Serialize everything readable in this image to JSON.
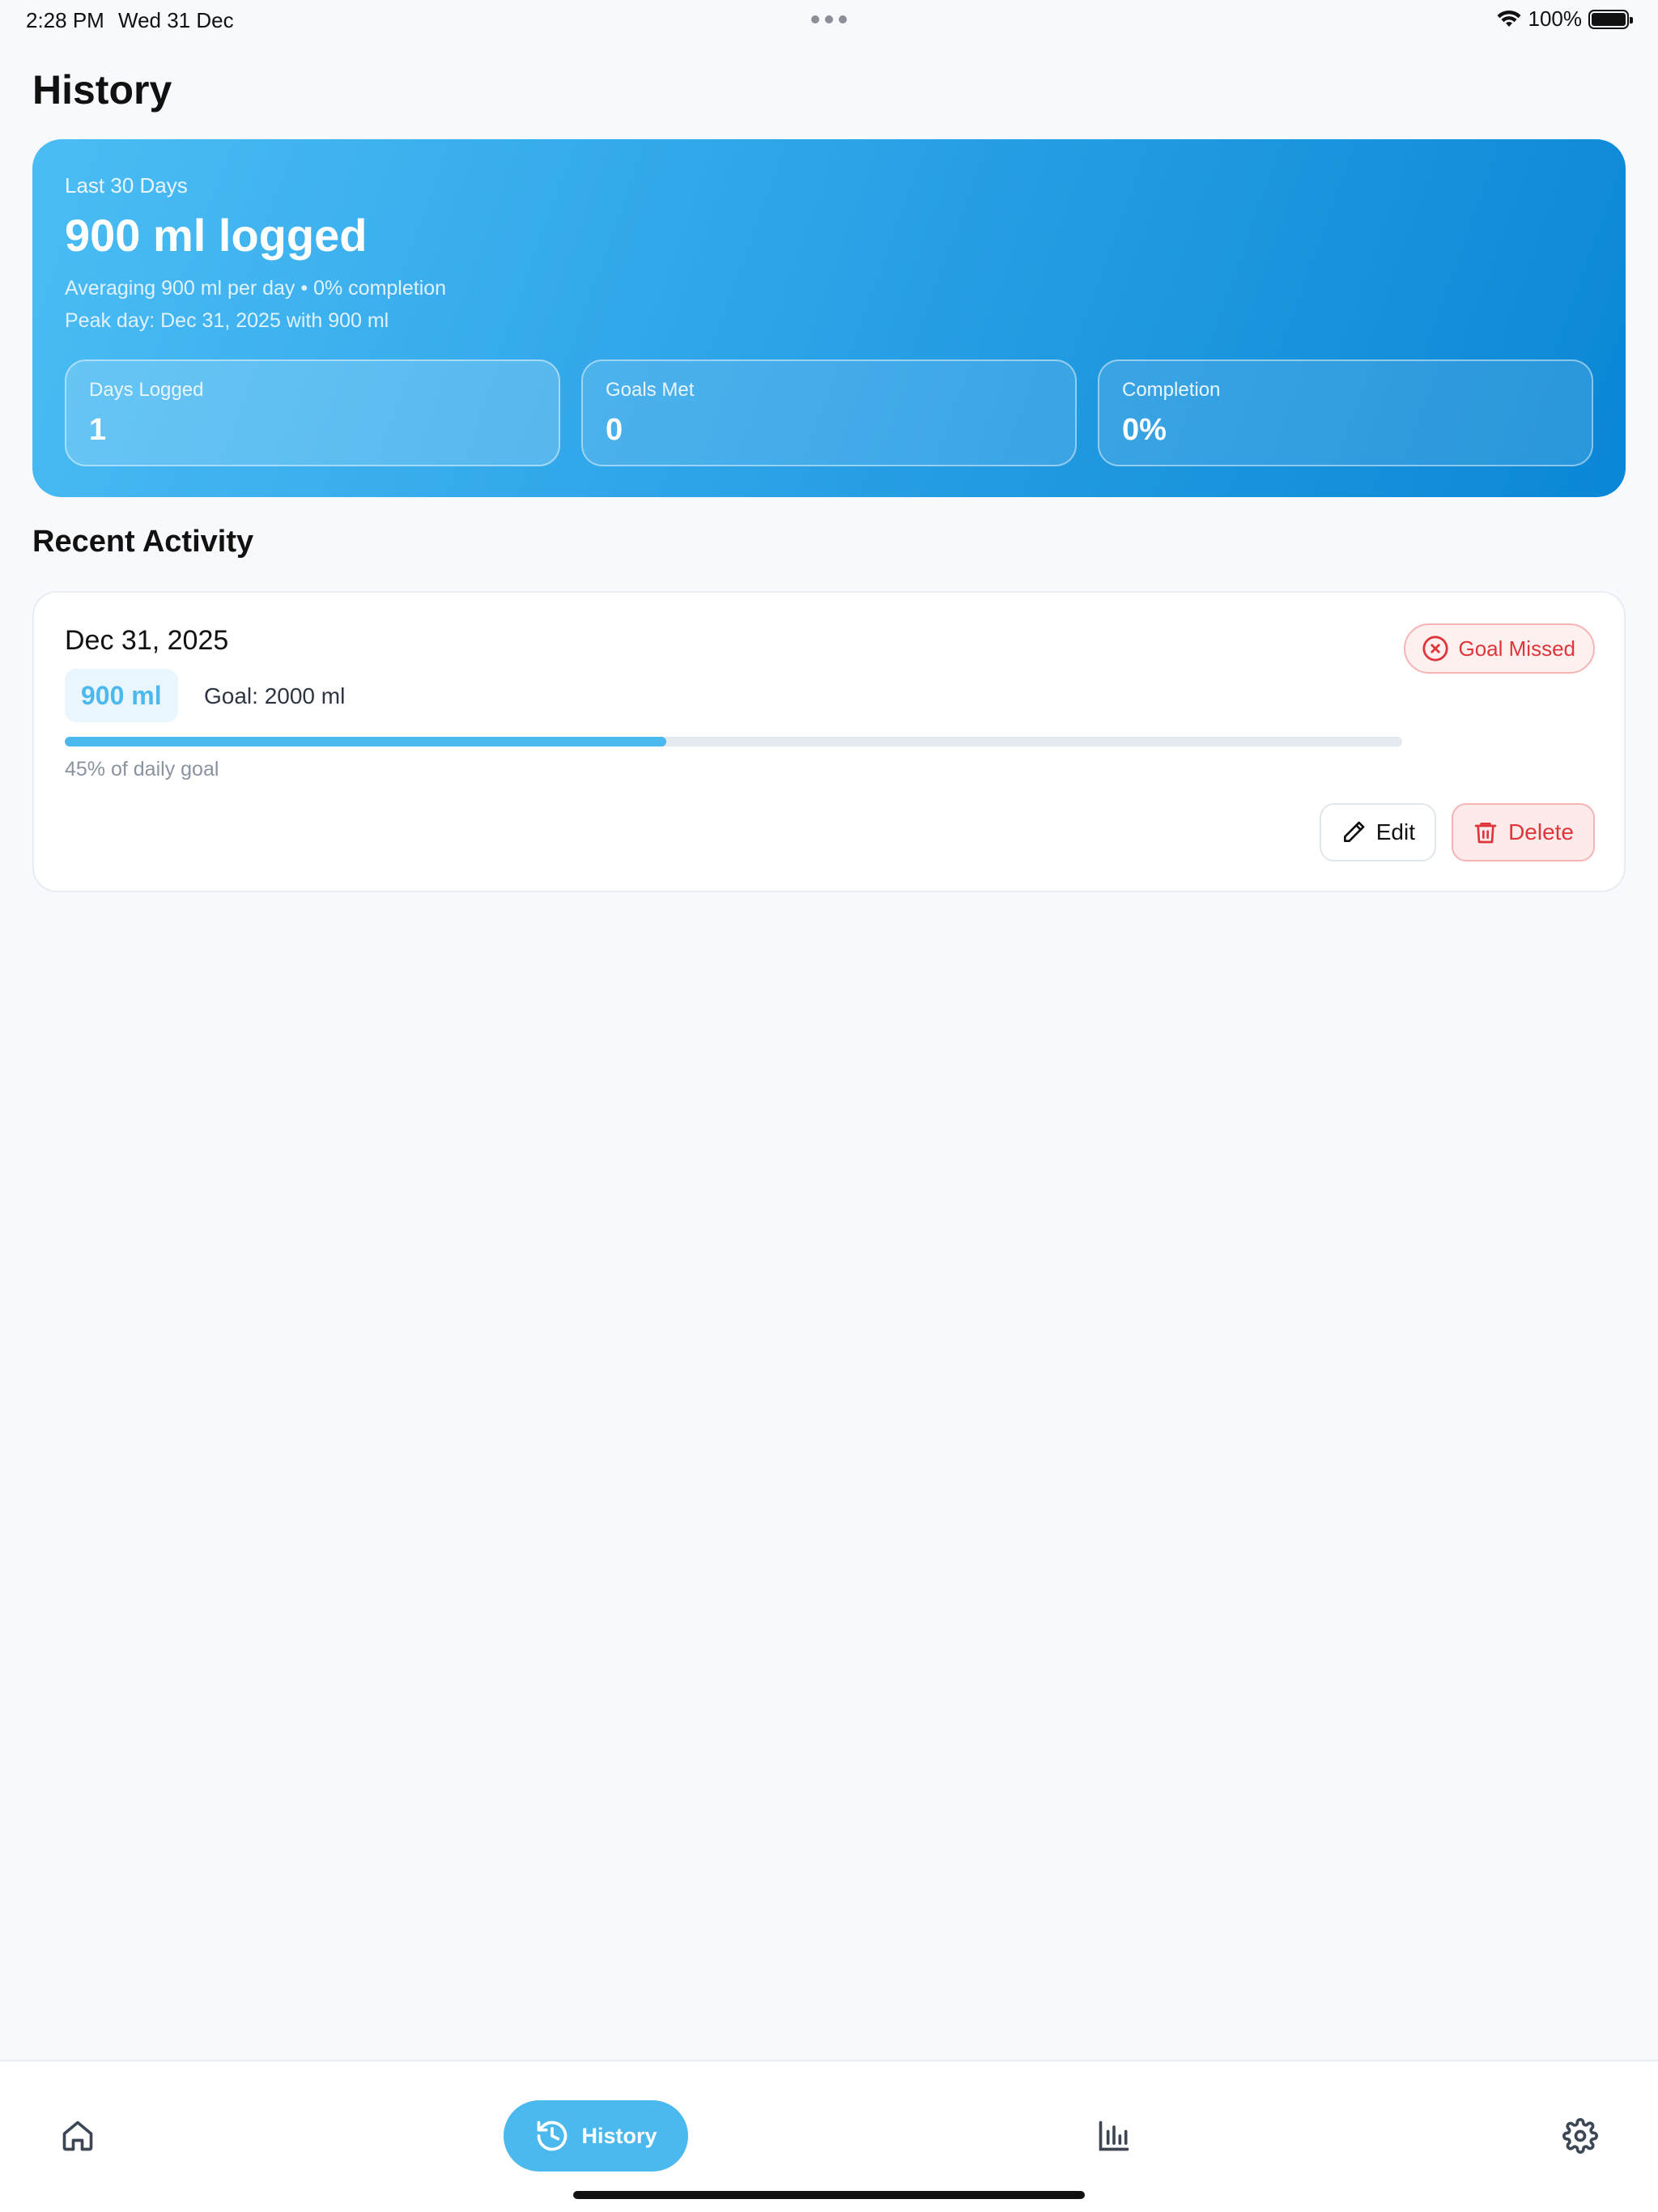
{
  "status_bar": {
    "time": "2:28 PM",
    "date": "Wed 31 Dec",
    "battery": "100%"
  },
  "page": {
    "title": "History"
  },
  "summary": {
    "period": "Last 30 Days",
    "total": "900 ml logged",
    "average_line": "Averaging 900 ml per day • 0% completion",
    "peak_line": "Peak day: Dec 31, 2025 with 900 ml",
    "stats": [
      {
        "label": "Days Logged",
        "value": "1"
      },
      {
        "label": "Goals Met",
        "value": "0"
      },
      {
        "label": "Completion",
        "value": "0%"
      }
    ]
  },
  "recent": {
    "title": "Recent Activity",
    "entries": [
      {
        "date": "Dec 31, 2025",
        "amount": "900 ml",
        "goal": "Goal: 2000 ml",
        "progress_fraction": 0.45,
        "progress_text": "45% of daily goal",
        "status": "Goal Missed",
        "edit_label": "Edit",
        "delete_label": "Delete"
      }
    ]
  },
  "nav": {
    "items": [
      {
        "icon": "home-icon"
      },
      {
        "icon": "history-icon",
        "label": "History",
        "active": true
      },
      {
        "icon": "bar-chart-icon"
      },
      {
        "icon": "gear-icon"
      }
    ]
  },
  "colors": {
    "accent": "#4cb9ee",
    "danger": "#e0353a",
    "card_gradient_start": "#4bbdf4",
    "card_gradient_end": "#0a87d5",
    "background": "#f7f9fc"
  }
}
